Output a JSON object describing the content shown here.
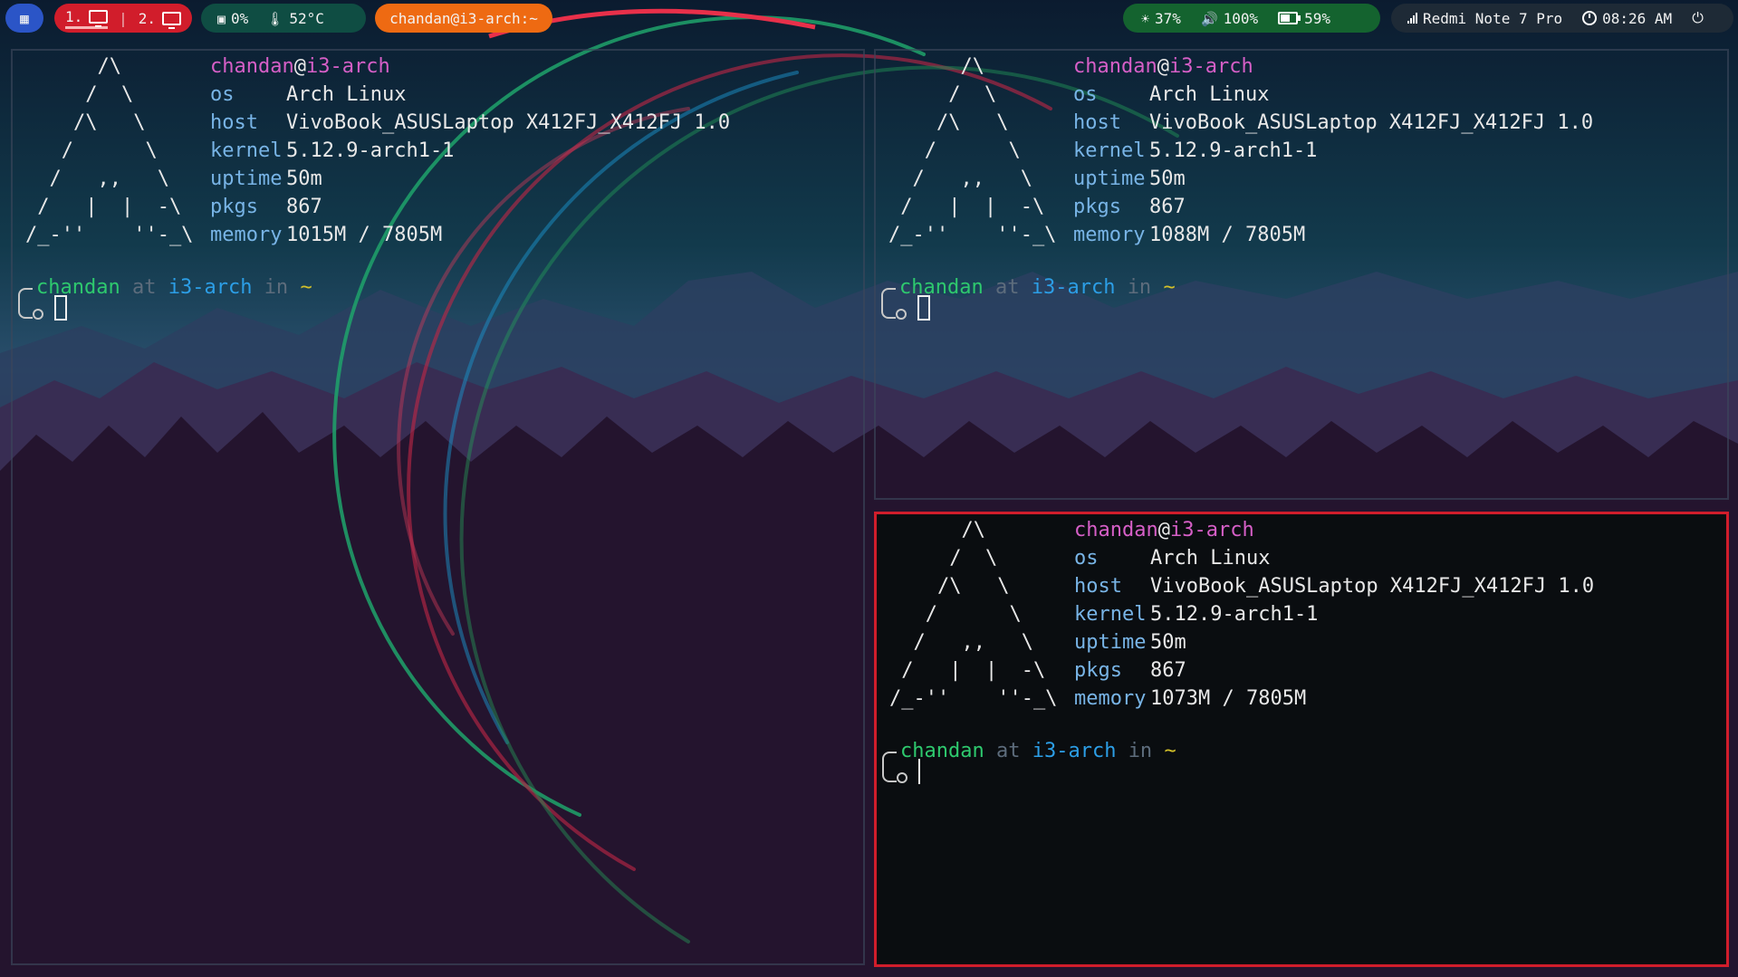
{
  "bar": {
    "workspaces": [
      {
        "label": "1.",
        "active": true
      },
      {
        "label": "2.",
        "active": false
      }
    ],
    "separator": "|",
    "cpu": "0%",
    "temp": "52°C",
    "window_title": "chandan@i3-arch:~",
    "brightness": "37%",
    "volume": "100%",
    "battery": "59%",
    "network": "Redmi Note 7 Pro",
    "time": "08:26 AM",
    "colors": {
      "menu": "#2b55c7",
      "workspaces": "#d11d2b",
      "system": "#0f4d43",
      "title": "#ee6a12",
      "status": "#14632f",
      "clock": "#1e2a36"
    }
  },
  "terminals": [
    {
      "user": "chandan",
      "host": "i3-arch",
      "os": "Arch Linux",
      "hostname": "VivoBook_ASUSLaptop X412FJ_X412FJ 1.0",
      "kernel": "5.12.9-arch1-1",
      "uptime": "50m",
      "pkgs": "867",
      "memory": "1015M / 7805M",
      "focused": false
    },
    {
      "user": "chandan",
      "host": "i3-arch",
      "os": "Arch Linux",
      "hostname": "VivoBook_ASUSLaptop X412FJ_X412FJ 1.0",
      "kernel": "5.12.9-arch1-1",
      "uptime": "50m",
      "pkgs": "867",
      "memory": "1088M / 7805M",
      "focused": false
    },
    {
      "user": "chandan",
      "host": "i3-arch",
      "os": "Arch Linux",
      "hostname": "VivoBook_ASUSLaptop X412FJ_X412FJ 1.0",
      "kernel": "5.12.9-arch1-1",
      "uptime": "50m",
      "pkgs": "867",
      "memory": "1073M / 7805M",
      "focused": true
    }
  ],
  "labels": {
    "at_symbol": "@",
    "os": "os",
    "host": "host",
    "kernel": "kernel",
    "uptime": "uptime",
    "pkgs": "pkgs",
    "memory": "memory",
    "prompt_at": "at",
    "prompt_in": "in",
    "prompt_dir": "~"
  },
  "ascii_logo": "      /\\\n     /  \\\n    /\\   \\\n   /      \\\n  /   ,,   \\\n /   |  |  -\\\n/_-''    ''-_\\",
  "focus_border_color": "#d11d2b"
}
